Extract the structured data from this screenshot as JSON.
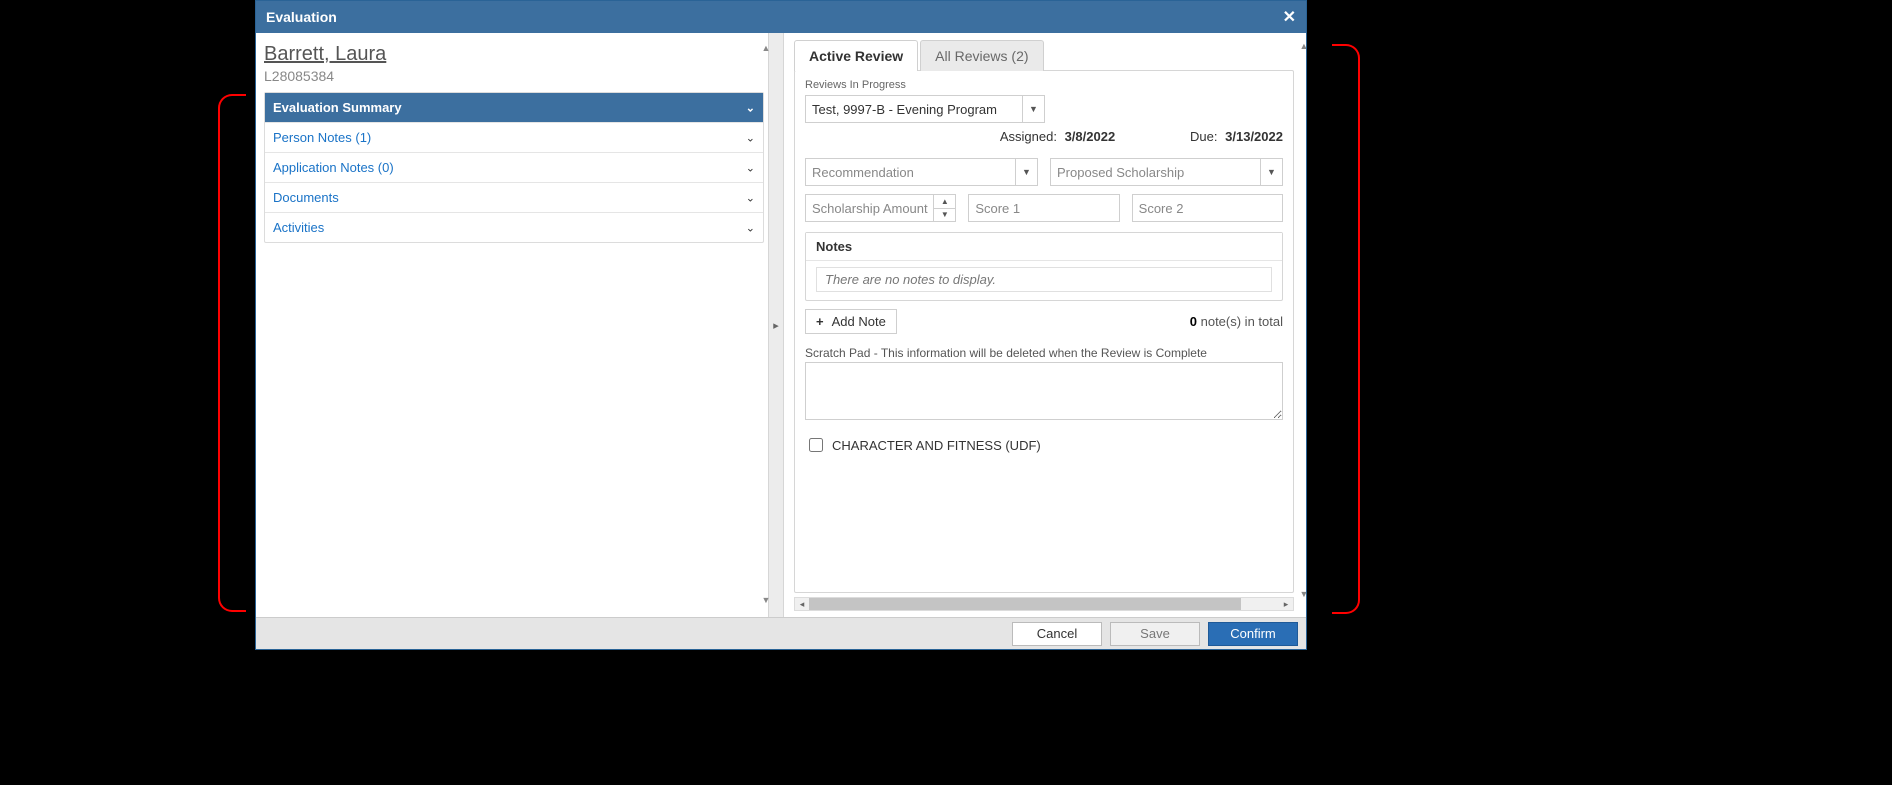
{
  "modal": {
    "title": "Evaluation"
  },
  "person": {
    "name": "Barrett, Laura",
    "id": "L28085384"
  },
  "accordion": {
    "items": [
      {
        "label": "Evaluation Summary",
        "active": true
      },
      {
        "label": "Person Notes (1)"
      },
      {
        "label": "Application Notes (0)"
      },
      {
        "label": "Documents"
      },
      {
        "label": "Activities"
      }
    ]
  },
  "tabs": {
    "active": "Active Review",
    "all": "All Reviews (2)"
  },
  "review": {
    "progress_label": "Reviews In Progress",
    "selected": "Test, 9997-B - Evening Program",
    "assigned_label": "Assigned:",
    "assigned_value": "3/8/2022",
    "due_label": "Due:",
    "due_value": "3/13/2022",
    "recommendation_ph": "Recommendation",
    "scholarship_ph": "Proposed Scholarship",
    "amount_ph": "Scholarship Amount",
    "score1_ph": "Score 1",
    "score2_ph": "Score 2",
    "notes_header": "Notes",
    "notes_empty": "There are no notes to display.",
    "add_note": "Add Note",
    "notes_total_count": "0",
    "notes_total_suffix": " note(s) in total",
    "scratch_label": "Scratch Pad - This information will be deleted when the Review is Complete",
    "udf_label": "CHARACTER AND FITNESS (UDF)"
  },
  "footer": {
    "cancel": "Cancel",
    "save": "Save",
    "confirm": "Confirm"
  }
}
